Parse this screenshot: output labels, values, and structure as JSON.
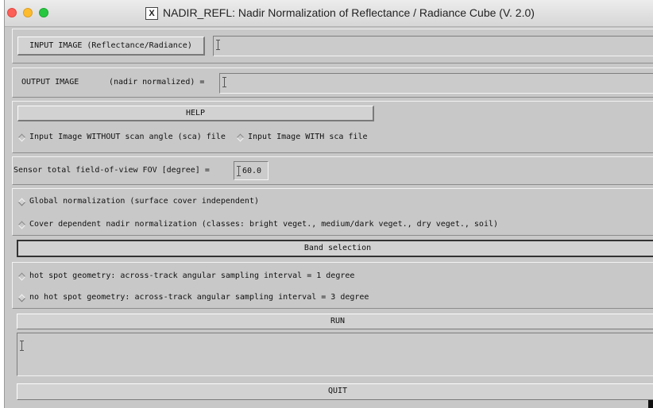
{
  "window": {
    "title": "NADIR_REFL: Nadir Normalization of Reflectance / Radiance Cube  (V. 2.0)",
    "title_icon": "X"
  },
  "input": {
    "button_label": "INPUT IMAGE (Reflectance/Radiance)",
    "value": ""
  },
  "output": {
    "label_a": "OUTPUT IMAGE",
    "label_b": "(nadir normalized) =",
    "value": ""
  },
  "help": {
    "label": "HELP"
  },
  "sca_options": [
    {
      "label": "Input Image WITHOUT scan angle (sca) file",
      "selected": false
    },
    {
      "label": "Input Image WITH sca file",
      "selected": false
    }
  ],
  "fov": {
    "label": "Sensor total field-of-view   FOV [degree] =",
    "value": "60.0"
  },
  "normalization_options": [
    {
      "label": "Global normalization (surface cover independent)",
      "selected": true
    },
    {
      "label": "Cover dependent nadir normalization (classes: bright veget., medium/dark veget., dry veget., soil)",
      "selected": false
    }
  ],
  "band_selection": {
    "label": "Band selection"
  },
  "hotspot_options": [
    {
      "label": "hot spot geometry: across-track angular sampling interval = 1 degree",
      "selected": false
    },
    {
      "label": "no hot spot geometry: across-track angular sampling interval = 3 degree",
      "selected": true
    }
  ],
  "run": {
    "label": "RUN"
  },
  "log": {
    "value": ""
  },
  "quit": {
    "label": "QUIT"
  }
}
